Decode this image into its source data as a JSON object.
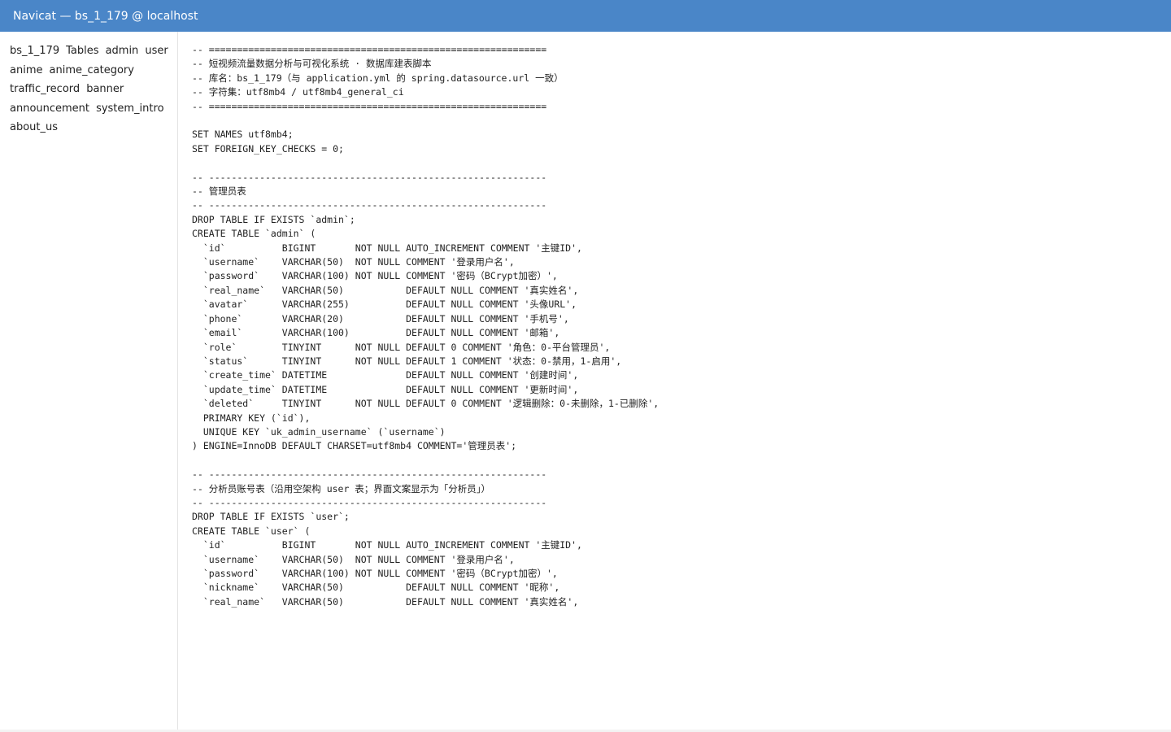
{
  "window": {
    "title": "Navicat — bs_1_179 @ localhost"
  },
  "sidebar": {
    "lines": [
      [
        "bs_1_179",
        "Tables",
        "admin",
        "user"
      ],
      [
        "anime",
        "anime_category"
      ],
      [
        "traffic_record",
        "banner"
      ],
      [
        "announcement",
        "system_intro"
      ],
      [
        "about_us"
      ]
    ]
  },
  "editor": {
    "lines": [
      "-- ============================================================",
      "-- 短视频流量数据分析与可视化系统 · 数据库建表脚本",
      "-- 库名：bs_1_179（与 application.yml 的 spring.datasource.url 一致）",
      "-- 字符集：utf8mb4 / utf8mb4_general_ci",
      "-- ============================================================",
      "",
      "SET NAMES utf8mb4;",
      "SET FOREIGN_KEY_CHECKS = 0;",
      "",
      "-- ------------------------------------------------------------",
      "-- 管理员表",
      "-- ------------------------------------------------------------",
      "DROP TABLE IF EXISTS `admin`;",
      "CREATE TABLE `admin` (",
      "  `id`          BIGINT       NOT NULL AUTO_INCREMENT COMMENT '主键ID',",
      "  `username`    VARCHAR(50)  NOT NULL COMMENT '登录用户名',",
      "  `password`    VARCHAR(100) NOT NULL COMMENT '密码（BCrypt加密）',",
      "  `real_name`   VARCHAR(50)           DEFAULT NULL COMMENT '真实姓名',",
      "  `avatar`      VARCHAR(255)          DEFAULT NULL COMMENT '头像URL',",
      "  `phone`       VARCHAR(20)           DEFAULT NULL COMMENT '手机号',",
      "  `email`       VARCHAR(100)          DEFAULT NULL COMMENT '邮箱',",
      "  `role`        TINYINT      NOT NULL DEFAULT 0 COMMENT '角色：0-平台管理员',",
      "  `status`      TINYINT      NOT NULL DEFAULT 1 COMMENT '状态：0-禁用，1-启用',",
      "  `create_time` DATETIME              DEFAULT NULL COMMENT '创建时间',",
      "  `update_time` DATETIME              DEFAULT NULL COMMENT '更新时间',",
      "  `deleted`     TINYINT      NOT NULL DEFAULT 0 COMMENT '逻辑删除：0-未删除，1-已删除',",
      "  PRIMARY KEY (`id`),",
      "  UNIQUE KEY `uk_admin_username` (`username`)",
      ") ENGINE=InnoDB DEFAULT CHARSET=utf8mb4 COMMENT='管理员表';",
      "",
      "-- ------------------------------------------------------------",
      "-- 分析员账号表（沿用空架构 user 表；界面文案显示为「分析员」）",
      "-- ------------------------------------------------------------",
      "DROP TABLE IF EXISTS `user`;",
      "CREATE TABLE `user` (",
      "  `id`          BIGINT       NOT NULL AUTO_INCREMENT COMMENT '主键ID',",
      "  `username`    VARCHAR(50)  NOT NULL COMMENT '登录用户名',",
      "  `password`    VARCHAR(100) NOT NULL COMMENT '密码（BCrypt加密）',",
      "  `nickname`    VARCHAR(50)           DEFAULT NULL COMMENT '昵称',",
      "  `real_name`   VARCHAR(50)           DEFAULT NULL COMMENT '真实姓名',"
    ]
  }
}
